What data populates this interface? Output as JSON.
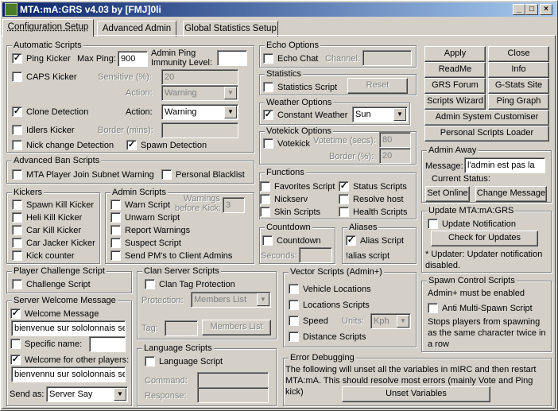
{
  "window": {
    "title": "MTA:mA:GRS v4.03 by [FMJ]0li",
    "min": "_",
    "max": "□",
    "close": "×"
  },
  "tabs": [
    "Configuration Setup",
    "Advanced Admin",
    "Global Statistics Setup"
  ],
  "check": "✓",
  "dropdown_arrow": "▼",
  "automatic": {
    "title": "Automatic Scripts",
    "ping_kicker": "Ping Kicker",
    "max_ping_label": "Max Ping:",
    "max_ping": "900",
    "admin_ping_label": "Admin Ping",
    "immunity_label": "Immunity Level:",
    "immunity": "",
    "caps_kicker": "CAPS Kicker",
    "sensitive_label": "Sensitive (%):",
    "sensitive": "20",
    "action_label": "Action:",
    "caps_action": "Warning",
    "clone": "Clone Detection",
    "clone_action": "Warning",
    "idlers": "Idlers Kicker",
    "border_label": "Border (mins):",
    "border": "",
    "nick_change": "Nick change Detection",
    "spawn_detection": "Spawn Detection"
  },
  "ban": {
    "title": "Advanced Ban Scripts",
    "subnet": "MTA Player Join Subnet Warning",
    "blacklist": "Personal Blacklist"
  },
  "kickers": {
    "title": "Kickers",
    "items": [
      "Spawn Kill Kicker",
      "Heli Kill Kicker",
      "Car Kill Kicker",
      "Car Jacker Kicker",
      "Kick counter"
    ]
  },
  "admin": {
    "title": "Admin Scripts",
    "items": [
      "Warn Script",
      "Unwarn Script",
      "Report Warnings",
      "Suspect Script",
      "Send PM's to Client Admins"
    ],
    "warnings_label": "Warnings",
    "before_kick_label": "before Kick:",
    "warnings": "3"
  },
  "challenge": {
    "title": "Player Challenge Script",
    "item": "Challenge Script"
  },
  "welcome": {
    "title": "Server Welcome Message",
    "welcome_msg": "Welcome Message",
    "msg1": "bienvenue sur sololonnais se",
    "specific": "Specific name:",
    "specific_value": "",
    "other": "Welcome for other players:",
    "msg2": "bienvennu sur sololonnais se",
    "send_as_label": "Send as:",
    "send_as": "Server Say"
  },
  "clan": {
    "title": "Clan Server Scripts",
    "item": "Clan Tag Protection",
    "protection_label": "Protection:",
    "protection": "Members List",
    "tag_label": "Tag:",
    "tag": "",
    "members_button": "Members List"
  },
  "language": {
    "title": "Language Scripts",
    "item": "Language Script",
    "command_label": "Command:",
    "command": "",
    "response_label": "Response:",
    "response": ""
  },
  "echo": {
    "title": "Echo Options",
    "item": "Echo Chat",
    "channel_label": "Channel:",
    "channel": ""
  },
  "statistics": {
    "title": "Statistics",
    "item": "Statistics Script",
    "reset": "Reset"
  },
  "weather": {
    "title": "Weather Options",
    "item": "Constant Weather",
    "value": "Sun"
  },
  "votekick": {
    "title": "Votekick Options",
    "item": "Votekick",
    "votetime_label": "Votetime (secs):",
    "votetime": "80",
    "border_label": "Border (%):",
    "border": "20"
  },
  "functions": {
    "title": "Functions",
    "items": [
      "Favorites Script",
      "Status Scripts",
      "Nickserv",
      "Resolve host",
      "Skin Scripts",
      "Health Scripts"
    ]
  },
  "countdown": {
    "title": "Countdown",
    "item": "Countdown",
    "seconds_label": "Seconds:",
    "seconds": ""
  },
  "aliases": {
    "title": "Aliases",
    "item": "Alias Script",
    "hint": "!alias script"
  },
  "vector": {
    "title": "Vector Scripts (Admin+)",
    "items": [
      "Vehicle Locations",
      "Locations Scripts",
      "Speed",
      "Distance Scripts"
    ],
    "units_label": "Units:",
    "units": "Kph"
  },
  "errors": {
    "title": "Error Debugging",
    "text": "The following will unset all the variables in mIRC and then restart MTA:mA. This should resolve most errors (mainly Vote and Ping kick)",
    "button": "Unset Variables"
  },
  "buttons": [
    "Apply",
    "Close",
    "ReadMe",
    "Info",
    "GRS Forum",
    "G-Stats Site",
    "Scripts Wizard",
    "Ping Graph"
  ],
  "customiser": "Admin System Customiser",
  "loader": "Personal Scripts Loader",
  "away": {
    "title": "Admin Away",
    "message_label": "Message:",
    "message": "l'admin est pas la",
    "status_label": "Current Status:",
    "set_online": "Set Online",
    "change": "Change Message"
  },
  "update": {
    "title": "Update MTA:mA:GRS",
    "item": "Update Notification",
    "check_button": "Check for Updates",
    "note": "* Updater: Updater notification disabled."
  },
  "spawn": {
    "title": "Spawn Control Scripts",
    "admin_note": "Admin+ must be enabled",
    "item": "Anti Multi-Spawn Script",
    "desc": "Stops players from spawning as the same character twice in a row"
  }
}
